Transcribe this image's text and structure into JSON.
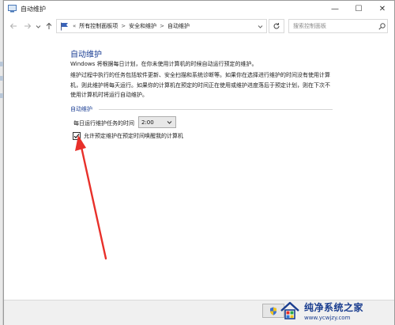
{
  "window": {
    "title": "自动维护",
    "controls": {
      "minimize": "—",
      "maximize": "☐",
      "close": "✕"
    }
  },
  "navbar": {
    "back_icon": "arrow-left-icon",
    "forward_icon": "arrow-right-icon",
    "recent_icon": "chevron-down-icon",
    "up_icon": "arrow-up-icon",
    "overflow": "«",
    "breadcrumbs": [
      "所有控制面板项",
      "安全和维护",
      "自动维护"
    ],
    "separators": [
      ">",
      ">"
    ],
    "refresh_icon": "refresh-icon",
    "search_placeholder": "搜索控制面板"
  },
  "main": {
    "title": "自动维护",
    "intro": "Windows 将根据每日计划，在你未使用计算机的时候自动运行预定的维护。",
    "description": [
      "维护过程中执行的任务包括软件更新、安全扫描和系统诊断等。如果你在选择进行维护的时间没有使用计算",
      "机，则此维护将每天运行。如果你的计算机在预定的时间正在使用或维护进度落后于预定计划，则在下次不",
      "使用计算机时将运行自动维护。"
    ],
    "section_title": "自动维护",
    "time_label": "每日运行维护任务的时间",
    "time_value": "2:00",
    "wake_checkbox_label": "允许预定维护在预定时间唤醒我的计算机",
    "wake_checked": true
  },
  "annotation": {
    "arrow_color": "#e8302a"
  },
  "watermark": {
    "title": "纯净系统之家",
    "url": "www.ycwjzy.com"
  },
  "colors": {
    "accent": "#1c3f94",
    "arrow": "#e8302a"
  }
}
